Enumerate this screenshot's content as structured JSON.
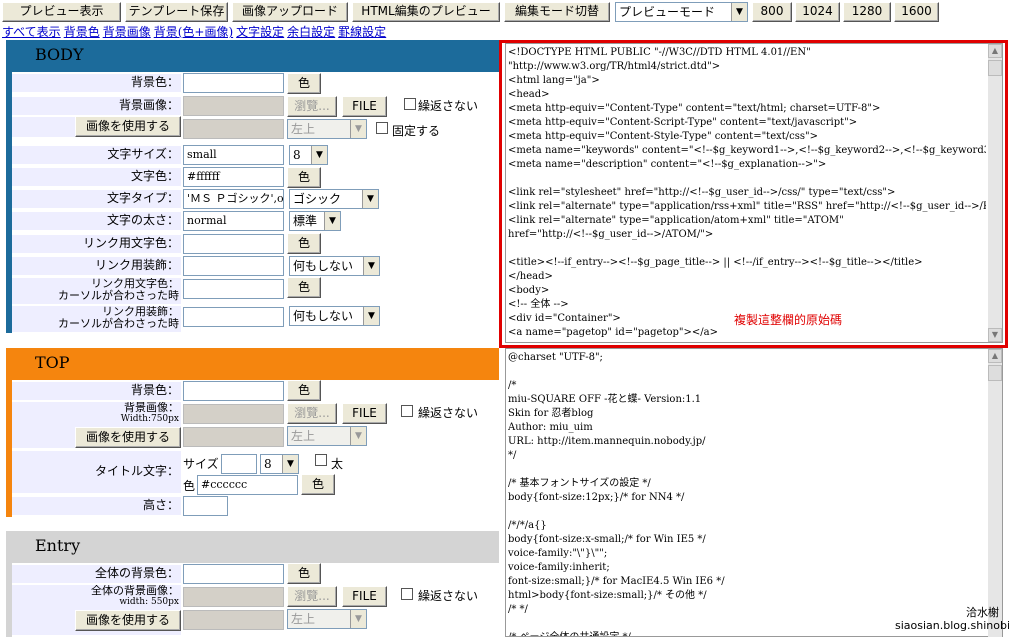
{
  "toolbar": {
    "preview": "プレビュー表示",
    "save_template": "テンプレート保存",
    "upload_image": "画像アップロード",
    "html_preview": "HTML編集のプレビュー",
    "toggle_mode": "編集モード切替",
    "mode_select": "プレビューモード",
    "w800": "800",
    "w1024": "1024",
    "w1280": "1280",
    "w1600": "1600"
  },
  "links": [
    "すべて表示",
    "背景色",
    "背景画像",
    "背景(色+画像)",
    "文字設定",
    "余白設定",
    "罫線設定"
  ],
  "common": {
    "color_btn": "色",
    "browse": "瀏覽...",
    "file": "FILE",
    "no_repeat": "繰返さない",
    "use_image": "画像を使用する",
    "position": "左上",
    "fixed": "固定する"
  },
  "body": {
    "title": "BODY",
    "accent": "#1c6b9b",
    "labels": {
      "bgcolor": "背景色：",
      "bgimage": "背景画像：",
      "fontsize": "文字サイズ：",
      "color": "文字色：",
      "fonttype": "文字タイプ：",
      "weight": "文字の太さ：",
      "linkcolor": "リンク用文字色：",
      "linkdeco": "リンク用装飾：",
      "hovercolor1": "リンク用文字色：",
      "hovercolor2": "カーソルが合わさった時",
      "hoverdeco1": "リンク用装飾：",
      "hoverdeco2": "カーソルが合わさった時"
    },
    "fontsize_val": "small",
    "fontsize_sel": "8",
    "color_val": "#ffffff",
    "font_val": "'ＭＳ Ｐゴシック',o",
    "font_sel": "ゴシック",
    "weight_val": "normal",
    "weight_sel": "標準",
    "deco_sel": "何もしない",
    "hoverdeco_sel": "何もしない"
  },
  "top": {
    "title": "TOP",
    "accent": "#f5850e",
    "labels": {
      "bgcolor": "背景色：",
      "bgimage": "背景画像：",
      "bgwidth": "Width:750px",
      "titletext": "タイトル文字：",
      "height": "高さ："
    },
    "size_label": "サイズ",
    "size_sel": "8",
    "bold": "太",
    "color_label": "色",
    "color_val": "#cccccc"
  },
  "entry": {
    "title": "Entry",
    "accent": "#d4d4d4",
    "labels": {
      "bgcolor": "全体の背景色：",
      "bgimage": "全体の背景画像：",
      "bgwidth": "width: 550px"
    }
  },
  "html_code": [
    "<!DOCTYPE HTML PUBLIC \"-//W3C//DTD HTML 4.01//EN\"",
    "\"http://www.w3.org/TR/html4/strict.dtd\">",
    "<html lang=\"ja\">",
    "<head>",
    "<meta http-equiv=\"Content-Type\" content=\"text/html; charset=UTF-8\">",
    "<meta http-equiv=\"Content-Script-Type\" content=\"text/javascript\">",
    "<meta http-equiv=\"Content-Style-Type\" content=\"text/css\">",
    "<meta name=\"keywords\" content=\"<!--$g_keyword1-->,<!--$g_keyword2-->,<!--$g_keyword3-->\">",
    "<meta name=\"description\" content=\"<!--$g_explanation-->\">",
    "",
    "<link rel=\"stylesheet\" href=\"http://<!--$g_user_id-->/css/\" type=\"text/css\">",
    "<link rel=\"alternate\" type=\"application/rss+xml\" title=\"RSS\" href=\"http://<!--$g_user_id-->/RSS/\">",
    "<link rel=\"alternate\" type=\"application/atom+xml\" title=\"ATOM\"",
    "href=\"http://<!--$g_user_id-->/ATOM/\">",
    "",
    "<title><!--if_entry--><!--$g_page_title--> || <!--/if_entry--><!--$g_title--></title>",
    "</head>",
    "<body>",
    "<!-- 全体 -->",
    "<div id=\"Container\">",
    "<a name=\"pagetop\" id=\"pagetop\"></a>"
  ],
  "annotation": "複製這整欄的原始碼",
  "css_code": [
    "@charset \"UTF-8\";",
    "",
    "/*",
    "miu-SQUARE OFF -花と蝶- Version:1.1",
    "Skin for 忍者blog",
    "Author: miu_uim",
    "URL: http://item.mannequin.nobody.jp/",
    "*/",
    "",
    "/* 基本フォントサイズの設定 */",
    "body{font-size:12px;}/* for NN4 */",
    "",
    "/*/*/a{}",
    "body{font-size:x-small;/* for Win IE5 */",
    "voice-family:\"\\\"}\\\"\";",
    "voice-family:inherit;",
    "font-size:small;}/* for MacIE4.5 Win IE6 */",
    "html>body{font-size:small;}/* その他 */",
    "/* */",
    "",
    "/* ページ全体の共通設定 */"
  ],
  "watermark": {
    "name": "洽水榭",
    "url": "siaosian.blog.shinobi.jp"
  }
}
